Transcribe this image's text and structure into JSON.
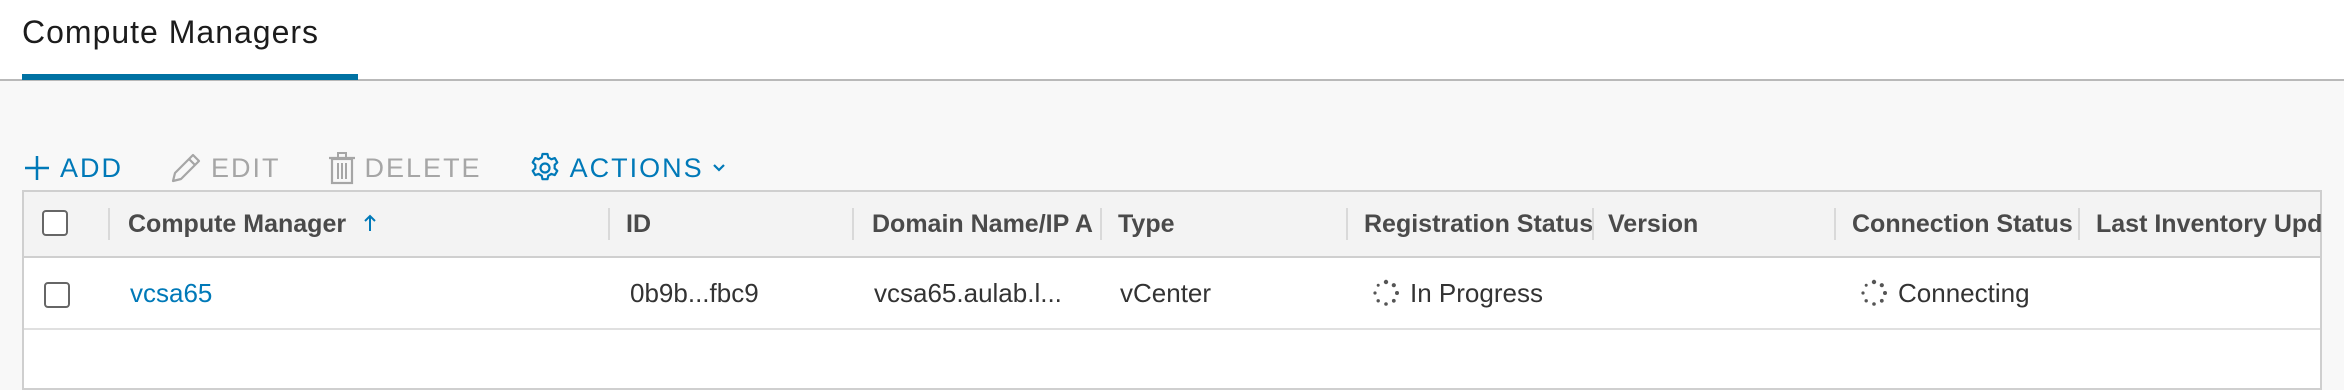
{
  "header": {
    "tab_title": "Compute Managers"
  },
  "toolbar": {
    "add_label": "ADD",
    "edit_label": "EDIT",
    "delete_label": "DELETE",
    "actions_label": "ACTIONS",
    "colors": {
      "enabled": "#0079b8",
      "disabled": "#a6a6a6"
    }
  },
  "grid": {
    "columns": [
      "Compute Manager",
      "ID",
      "Domain Name/IP A",
      "Type",
      "Registration Status",
      "Version",
      "Connection Status",
      "Last Inventory Upd"
    ],
    "sort": {
      "column": "Compute Manager",
      "direction": "ascending"
    },
    "rows": [
      {
        "compute_manager": "vcsa65",
        "id": "0b9b...fbc9",
        "domain": "vcsa65.aulab.l...",
        "type": "vCenter",
        "registration_status": "In Progress",
        "version": "",
        "connection_status": "Connecting",
        "last_inventory_update": ""
      }
    ]
  },
  "icons": {
    "add": "plus-icon",
    "edit": "pencil-icon",
    "delete": "trash-icon",
    "actions": "gear-icon",
    "actions_caret": "chevron-down-icon",
    "sort": "sort-ascending-arrow-icon",
    "status": "spinner-icon"
  },
  "colors": {
    "accent": "#0079b8",
    "tab_underline": "#0072a3"
  }
}
